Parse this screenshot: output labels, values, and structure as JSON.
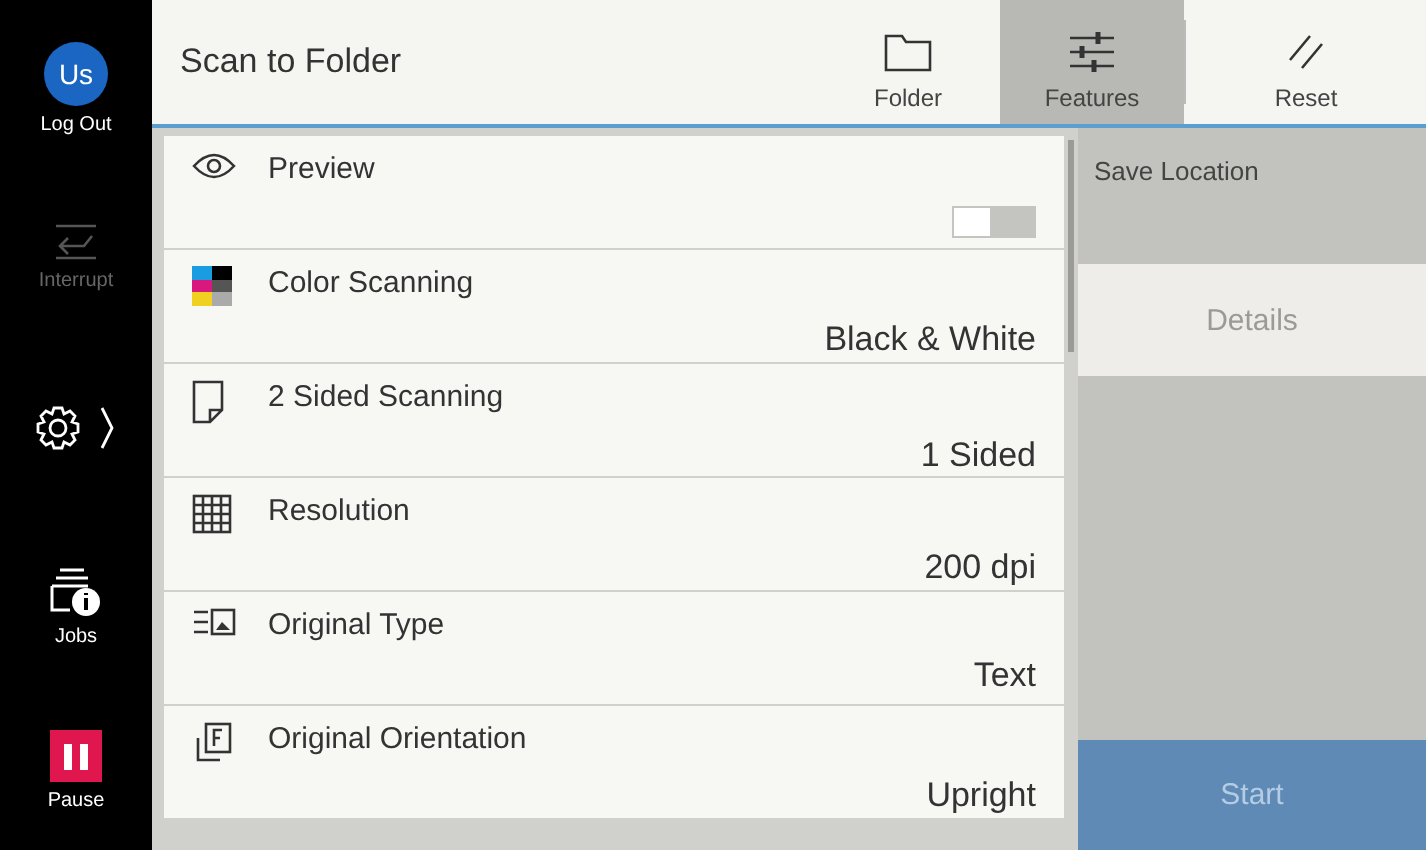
{
  "sidebar": {
    "items": [
      {
        "kind": "avatar",
        "initials": "Us",
        "label": "Log Out"
      },
      {
        "kind": "interrupt",
        "label": "Interrupt",
        "disabled": true
      },
      {
        "kind": "settings"
      },
      {
        "kind": "jobs",
        "label": "Jobs"
      },
      {
        "kind": "pause",
        "label": "Pause"
      }
    ]
  },
  "header": {
    "title": "Scan to Folder",
    "tabs": [
      {
        "kind": "folder",
        "label": "Folder",
        "selected": false
      },
      {
        "kind": "features",
        "label": "Features",
        "selected": true
      }
    ],
    "reset": {
      "label": "Reset"
    }
  },
  "features": [
    {
      "kind": "preview",
      "label": "Preview",
      "toggle_on": false
    },
    {
      "kind": "color",
      "label": "Color Scanning",
      "value": "Black & White"
    },
    {
      "kind": "sided",
      "label": "2 Sided Scanning",
      "value": "1 Sided"
    },
    {
      "kind": "resolution",
      "label": "Resolution",
      "value": "200 dpi"
    },
    {
      "kind": "type",
      "label": "Original Type",
      "value": "Text"
    },
    {
      "kind": "orientation",
      "label": "Original Orientation",
      "value": "Upright"
    }
  ],
  "side_panel": {
    "title": "Save Location",
    "details": {
      "label": "Details",
      "disabled": true
    },
    "start": {
      "label": "Start",
      "disabled": true
    }
  }
}
